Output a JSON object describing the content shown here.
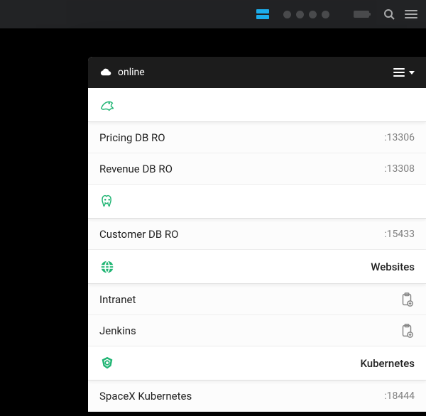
{
  "toolbar": {
    "server_icon": "server-icon",
    "search_icon": "search-icon",
    "menu_icon": "menu-icon"
  },
  "window": {
    "header": {
      "status": "online",
      "menu_icon": "menu-icon",
      "dropdown_icon": "chevron-down-icon"
    },
    "sections": [
      {
        "icon": "mysql-dolphin-icon",
        "label": "",
        "items": [
          {
            "name": "Pricing DB RO",
            "port": ":13306"
          },
          {
            "name": "Revenue DB RO",
            "port": ":13308"
          }
        ]
      },
      {
        "icon": "postgres-elephant-icon",
        "label": "",
        "items": [
          {
            "name": "Customer DB RO",
            "port": ":15433"
          }
        ]
      },
      {
        "icon": "globe-icon",
        "label": "Websites",
        "items": [
          {
            "name": "Intranet",
            "action_icon": "clipboard-add-icon"
          },
          {
            "name": "Jenkins",
            "action_icon": "clipboard-add-icon"
          }
        ]
      },
      {
        "icon": "kubernetes-icon",
        "label": "Kubernetes",
        "items": [
          {
            "name": "SpaceX Kubernetes",
            "port": ":18444"
          }
        ]
      }
    ]
  }
}
